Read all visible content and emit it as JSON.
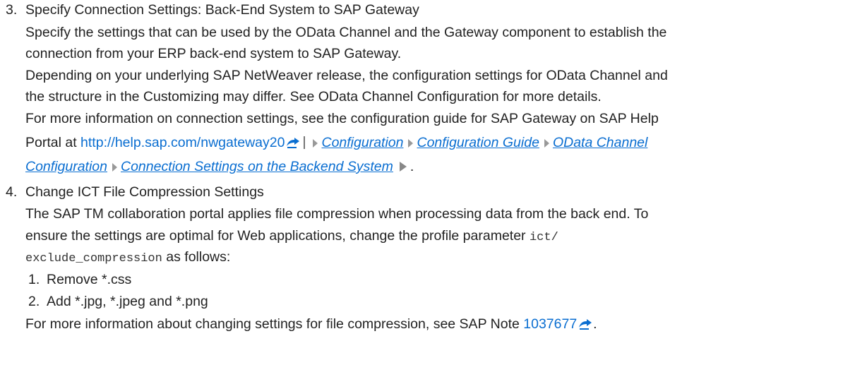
{
  "item3": {
    "number": "3.",
    "title": "Specify Connection Settings: Back-End System to SAP Gateway",
    "p1_line1": "Specify the settings that can be used by the OData Channel and the Gateway component to establish the",
    "p1_line2": "connection from your ERP back-end system to SAP Gateway.",
    "p2_line1": "Depending on your underlying SAP NetWeaver release, the configuration settings for OData Channel and",
    "p2_line2": "the structure in the Customizing may differ. See OData Channel Configuration for more details.",
    "p3_line1": "For more information on connection settings, see the configuration guide for SAP Gateway on SAP Help",
    "p3_line2_prefix": "Portal at ",
    "link_url": "http://help.sap.com/nwgateway20",
    "nav_path": [
      "Configuration",
      "Configuration Guide",
      "OData Channel",
      "Configuration",
      "Connection Settings on the Backend System"
    ],
    "end_punct": "."
  },
  "item4": {
    "number": "4.",
    "title": "Change ICT File Compression Settings",
    "p1_line1": "The SAP TM collaboration portal applies file compression when processing data from the back end. To",
    "p1_line2_prefix": "ensure the settings are optimal for Web applications, change the profile parameter ",
    "param_part1": "ict/",
    "param_part2": "exclude_compression",
    "p1_line3_suffix": " as follows:",
    "sub_items": [
      {
        "number": "1.",
        "text": "Remove *.css"
      },
      {
        "number": "2.",
        "text": "Add *.jpg, *.jpeg and *.png"
      }
    ],
    "note_prefix": "For more information about changing settings for file compression, see SAP Note ",
    "note_link": "1037677",
    "note_suffix": "."
  },
  "colors": {
    "link": "#0a6ed1",
    "text": "#222222"
  },
  "icons": [
    "external-link-icon",
    "chevron-right-icon",
    "separator-bar-icon"
  ]
}
